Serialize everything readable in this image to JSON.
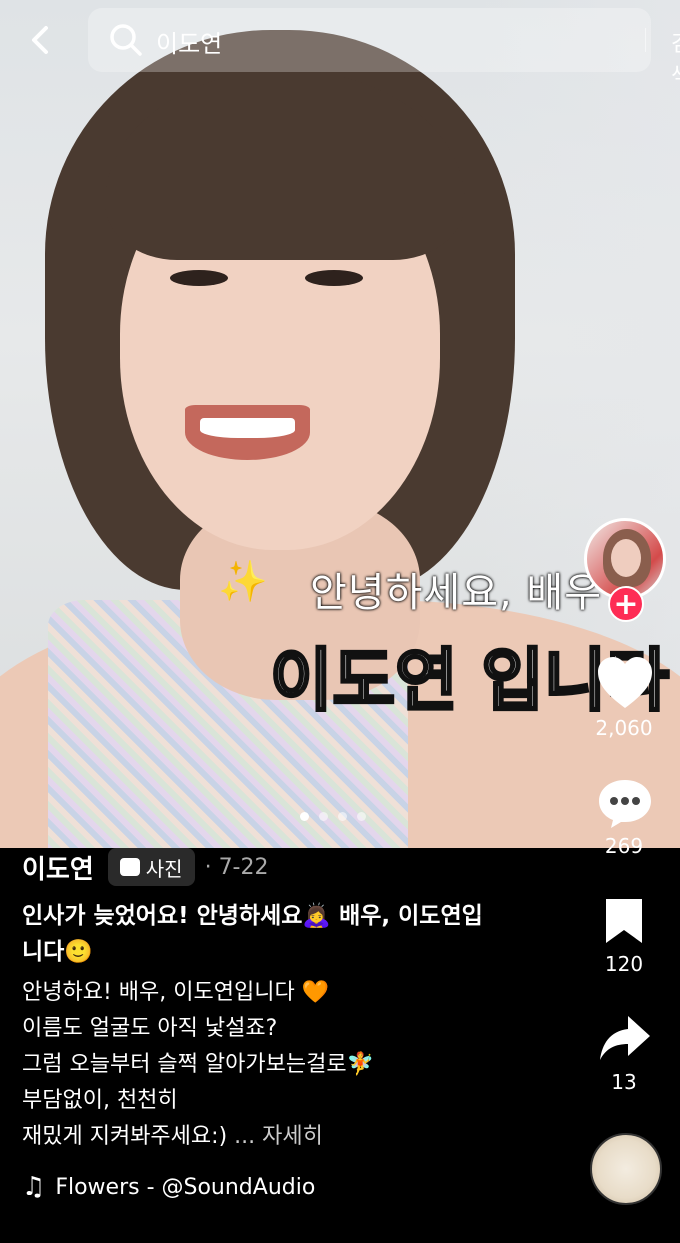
{
  "search": {
    "query": "이도연",
    "button_label": "검색"
  },
  "overlay": {
    "line1": "안녕하세요, 배우",
    "line2": "이도연 입니다"
  },
  "carousel": {
    "total": 4,
    "current": 1
  },
  "rail": {
    "likes": "2,060",
    "comments": "269",
    "bookmarks": "120",
    "shares": "13"
  },
  "post": {
    "author": "이도연",
    "type_label": "사진",
    "date": "· 7-22",
    "title": "인사가 늦었어요! 안녕하세요🙇‍♀️ 배우, 이도연입니다🙂",
    "body_lines": [
      "안녕하요! 배우, 이도연입니다 🧡",
      "이름도 얼굴도 아직 낯설죠?",
      "그럼 오늘부터 슬쩍 알아가보는걸로🧚",
      "부담없이, 천천히",
      "재밌게 지켜봐주세요:) "
    ],
    "more_label": "... 자세히",
    "music": "Flowers - @SoundAudio"
  },
  "colors": {
    "follow_red": "#fe2c55",
    "background": "#000000"
  }
}
